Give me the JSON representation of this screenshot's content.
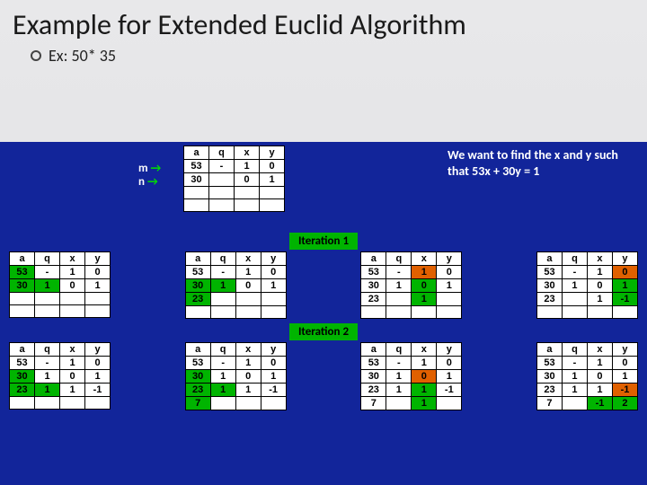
{
  "title": "Example for Extended Euclid Algorithm",
  "bullet_text": "Ex:  50* 35",
  "labels": {
    "m": "m",
    "n": "n",
    "arrow": "→"
  },
  "goal_text": "We want to find the x and y such that 53x + 30y = 1",
  "iter1_label": "Iteration 1",
  "iter2_label": "Iteration 2",
  "headers": [
    "a",
    "q",
    "x",
    "y"
  ],
  "top_table": {
    "rows": [
      [
        "53",
        "-",
        "1",
        "0"
      ],
      [
        "30",
        "",
        "0",
        "1"
      ],
      [
        "",
        "",
        "",
        ""
      ],
      [
        "",
        "",
        "",
        ""
      ]
    ]
  },
  "chart_data": {
    "type": "table",
    "description": "Extended Euclid algorithm trace tables across iterations",
    "headers": [
      "a",
      "q",
      "x",
      "y"
    ],
    "initial": [
      [
        "53",
        "-",
        "1",
        "0"
      ],
      [
        "30",
        "",
        "0",
        "1"
      ]
    ],
    "iteration1": [
      {
        "rows": [
          [
            "53",
            "-",
            "1",
            "0"
          ],
          [
            "30",
            "1",
            "0",
            "1"
          ]
        ],
        "highlight_rows_green": [
          0,
          1
        ]
      },
      {
        "rows": [
          [
            "53",
            "-",
            "1",
            "0"
          ],
          [
            "30",
            "1",
            "0",
            "1"
          ],
          [
            "23",
            "",
            "",
            ""
          ]
        ],
        "highlight_rows_green": [
          1,
          2
        ]
      },
      {
        "rows": [
          [
            "53",
            "-",
            "1",
            "0"
          ],
          [
            "30",
            "1",
            "0",
            "1"
          ],
          [
            "23",
            "",
            "1",
            ""
          ]
        ],
        "highlight_cells_red": [
          [
            1,
            2
          ]
        ],
        "highlight_cells_green": [
          [
            2,
            2
          ]
        ]
      },
      {
        "rows": [
          [
            "53",
            "-",
            "1",
            "0"
          ],
          [
            "30",
            "1",
            "0",
            "1"
          ],
          [
            "23",
            "",
            "1",
            "-1"
          ]
        ],
        "highlight_cells_red": [
          [
            0,
            3
          ]
        ],
        "highlight_cells_green": [
          [
            1,
            3
          ],
          [
            2,
            3
          ]
        ]
      }
    ],
    "iteration2": [
      {
        "rows": [
          [
            "53",
            "-",
            "1",
            "0"
          ],
          [
            "30",
            "1",
            "0",
            "1"
          ],
          [
            "23",
            "1",
            "1",
            "-1"
          ]
        ],
        "highlight_rows_green": [
          1,
          2
        ]
      },
      {
        "rows": [
          [
            "53",
            "-",
            "1",
            "0"
          ],
          [
            "30",
            "1",
            "0",
            "1"
          ],
          [
            "23",
            "1",
            "1",
            "-1"
          ],
          [
            "7",
            "",
            "",
            ""
          ]
        ],
        "highlight_rows_green": [
          2,
          3
        ]
      },
      {
        "rows": [
          [
            "53",
            "-",
            "1",
            "0"
          ],
          [
            "30",
            "1",
            "0",
            "1"
          ],
          [
            "23",
            "1",
            "1",
            "-1"
          ],
          [
            "7",
            "",
            "1",
            ""
          ]
        ],
        "highlight_cells_red": [
          [
            1,
            2
          ]
        ],
        "highlight_cells_green": [
          [
            2,
            2
          ],
          [
            3,
            2
          ]
        ]
      },
      {
        "rows": [
          [
            "53",
            "-",
            "1",
            "0"
          ],
          [
            "30",
            "1",
            "0",
            "1"
          ],
          [
            "23",
            "1",
            "1",
            "-1"
          ],
          [
            "7",
            "",
            "-1",
            "2"
          ]
        ],
        "highlight_cells_red": [
          [
            2,
            3
          ]
        ],
        "highlight_cells_green": [
          [
            3,
            2
          ],
          [
            3,
            3
          ]
        ]
      }
    ]
  }
}
